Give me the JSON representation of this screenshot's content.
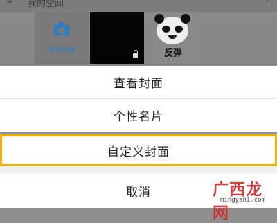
{
  "background": {
    "header_title": "我的空间",
    "tiles": {
      "post_label": "发布新鲜事",
      "panda_caption": "反弹"
    }
  },
  "action_sheet": {
    "options": [
      {
        "label": "查看封面"
      },
      {
        "label": "个性名片"
      },
      {
        "label": "自定义封面"
      }
    ],
    "cancel_label": "取消",
    "highlight_color": "#f2b300"
  },
  "watermark": {
    "logo": "广西龙网",
    "url": "mingyan1.com"
  }
}
